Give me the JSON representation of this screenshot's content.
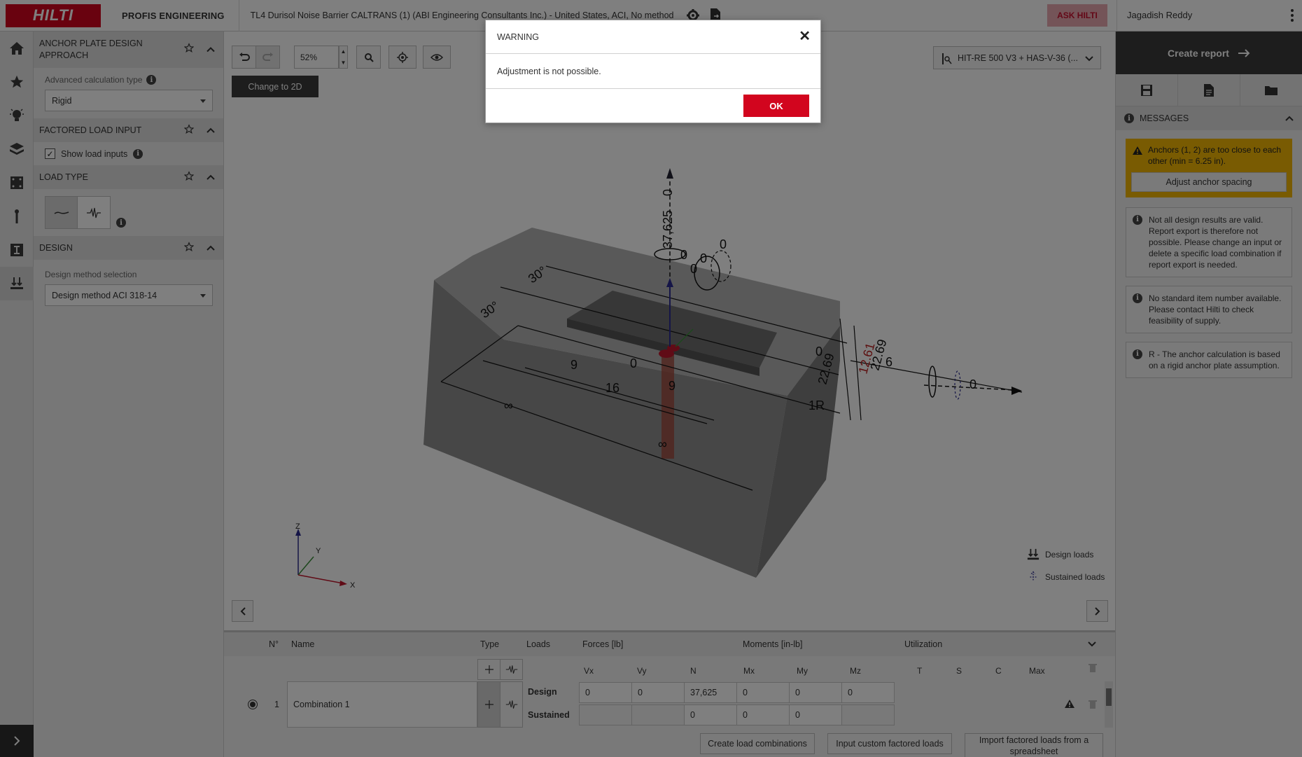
{
  "topbar": {
    "logo_text": "HILTI",
    "product": "PROFIS ENGINEERING",
    "project_title": "TL4 Durisol Noise Barrier CALTRANS (1) (ABI Engineering Consultants Inc.) - United States, ACI, No method",
    "ask_hilti": "ASK HILTI",
    "user_name": "Jagadish Reddy"
  },
  "leftpanel": {
    "anchor_plate": {
      "title": "ANCHOR PLATE DESIGN APPROACH",
      "calc_type_label": "Advanced calculation type",
      "calc_type_value": "Rigid"
    },
    "factored_load": {
      "title": "FACTORED LOAD INPUT",
      "show_load_inputs_label": "Show load inputs",
      "show_load_inputs_checked": true
    },
    "load_type": {
      "title": "LOAD TYPE"
    },
    "design": {
      "title": "DESIGN",
      "method_label": "Design method selection",
      "method_value": "Design method ACI 318-14"
    }
  },
  "canvas": {
    "zoom": "52%",
    "change_2d": "Change to 2D",
    "product_select": "HIT-RE 500 V3 + HAS-V-36 (...",
    "legend": {
      "design_loads": "Design loads",
      "sustained_loads": "Sustained loads"
    },
    "axes": {
      "z": "Z",
      "y": "Y",
      "x": "X"
    },
    "dims": {
      "n_load": "37,625",
      "zero": "0",
      "angle": "30°",
      "nine": "9",
      "sixteen": "16",
      "infinity": "∞",
      "thickness": "12.61",
      "d2269": "22.69",
      "six": "6",
      "one_r": "1R"
    }
  },
  "loadtable": {
    "headers": {
      "no": "N°",
      "name": "Name",
      "type": "Type",
      "loads": "Loads",
      "forces": "Forces [lb]",
      "moments": "Moments [in-lb]",
      "utilization": "Utilization"
    },
    "subheaders": [
      "Vx",
      "Vy",
      "N",
      "Mx",
      "My",
      "Mz",
      "T",
      "S",
      "C",
      "Max"
    ],
    "row": {
      "number": "1",
      "name": "Combination 1",
      "design_label": "Design",
      "sustained_label": "Sustained",
      "design_values": [
        "0",
        "0",
        "37,625",
        "0",
        "0",
        "0"
      ],
      "sustained_values": [
        "",
        "",
        "0",
        "0",
        "0",
        ""
      ]
    },
    "buttons": {
      "create_combinations": "Create load combinations",
      "custom_factored": "Input custom factored loads",
      "import_spreadsheet": "Import factored loads from a spreadsheet"
    }
  },
  "rightpanel": {
    "create_report": "Create report",
    "messages_title": "MESSAGES",
    "warning_text": "Anchors (1, 2) are too close to each other (min = 6.25 in).",
    "adjust_button": "Adjust anchor spacing",
    "info_messages": [
      "Not all design results are valid. Report export is therefore not possible. Please change an input or delete a specific load combination if report export is needed.",
      "No standard item number available. Please contact Hilti to check feasibility of supply.",
      "R - The anchor calculation is based on a rigid anchor plate assumption."
    ]
  },
  "dialog": {
    "title": "WARNING",
    "message": "Adjustment is not possible.",
    "ok_label": "OK"
  },
  "colors": {
    "brand_red": "#d2051e",
    "warning_yellow": "#f2b705",
    "dark_button": "#3a3a3a"
  }
}
